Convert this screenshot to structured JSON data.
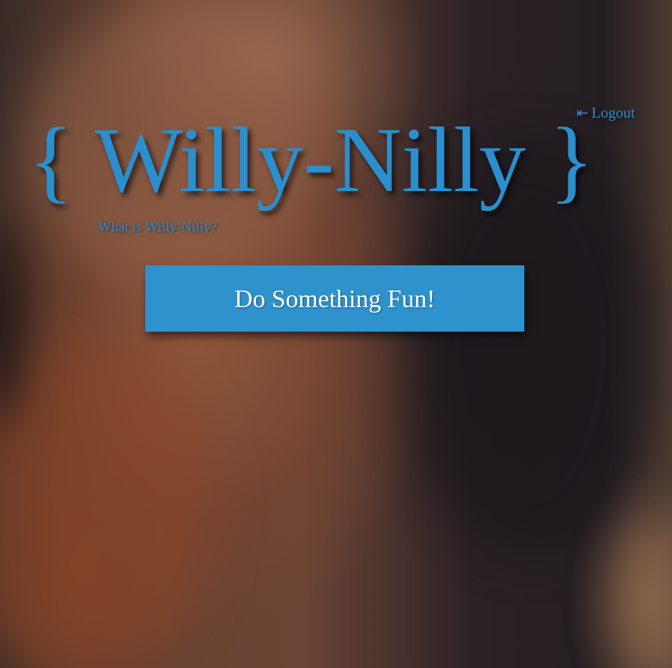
{
  "header": {
    "logout_icon": "⇤",
    "logout_label": "Logout",
    "brace_open": "{",
    "title": "Willy-Nilly",
    "brace_close": "}",
    "about_link": "What is Willy-Nilly?"
  },
  "main": {
    "action_button_label": "Do Something Fun!"
  },
  "colors": {
    "accent": "#2b8fcf",
    "button_bg": "#2e92cd",
    "button_text": "#ffffff"
  },
  "icons": {
    "logout": "arrow-left-to-bar-icon"
  }
}
